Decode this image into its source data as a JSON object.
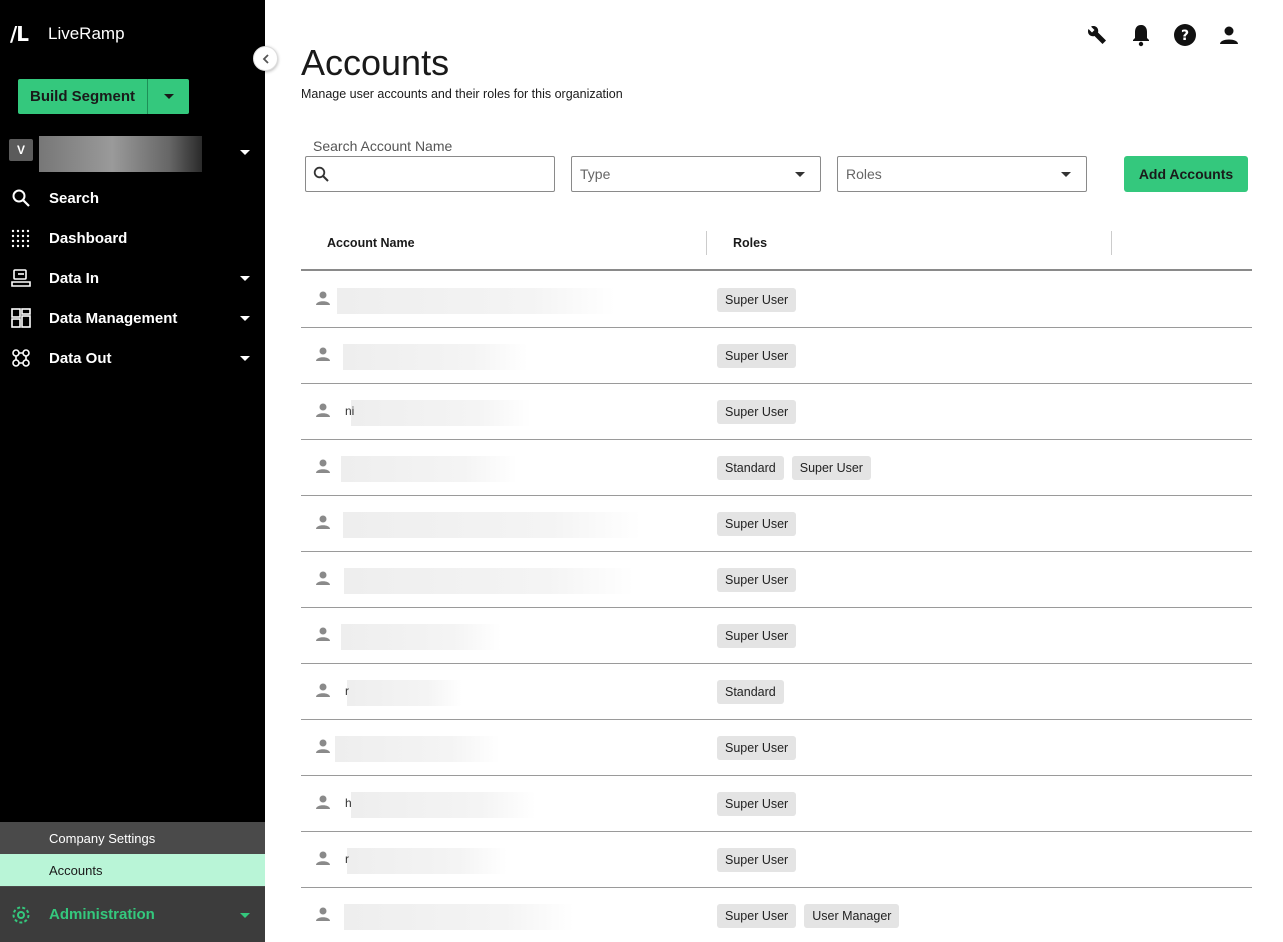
{
  "brand": {
    "mark": "/L",
    "name": "LiveRamp"
  },
  "sidebar": {
    "build_button": "Build Segment",
    "org_badge": "V",
    "nav": [
      {
        "label": "Search",
        "icon": "search-icon",
        "has_caret": false
      },
      {
        "label": "Dashboard",
        "icon": "dashboard-icon",
        "has_caret": false
      },
      {
        "label": "Data In",
        "icon": "data-in-icon",
        "has_caret": true
      },
      {
        "label": "Data Management",
        "icon": "data-management-icon",
        "has_caret": true
      },
      {
        "label": "Data Out",
        "icon": "data-out-icon",
        "has_caret": true
      }
    ],
    "admin_sub": [
      "Company Settings",
      "Accounts"
    ],
    "admin_label": "Administration"
  },
  "header": {
    "icons": [
      "wrench-icon",
      "bell-icon",
      "help-icon",
      "account-icon"
    ]
  },
  "page": {
    "title": "Accounts",
    "subtitle": "Manage user accounts and their roles for this organization"
  },
  "filters": {
    "search_label": "Search Account Name",
    "search_value": "",
    "type_placeholder": "Type",
    "roles_placeholder": "Roles",
    "add_button": "Add Accounts"
  },
  "table": {
    "columns": [
      "Account Name",
      "Roles"
    ],
    "rows": [
      {
        "initial": "",
        "roles": [
          "Super User"
        ]
      },
      {
        "initial": "",
        "roles": [
          "Super User"
        ]
      },
      {
        "initial": "ni",
        "roles": [
          "Super User"
        ]
      },
      {
        "initial": "",
        "roles": [
          "Standard",
          "Super User"
        ]
      },
      {
        "initial": "",
        "roles": [
          "Super User"
        ]
      },
      {
        "initial": "",
        "roles": [
          "Super User"
        ]
      },
      {
        "initial": "",
        "roles": [
          "Super User"
        ]
      },
      {
        "initial": "r",
        "roles": [
          "Standard"
        ]
      },
      {
        "initial": "",
        "roles": [
          "Super User"
        ]
      },
      {
        "initial": "h",
        "roles": [
          "Super User"
        ]
      },
      {
        "initial": "r",
        "roles": [
          "Super User"
        ]
      },
      {
        "initial": "",
        "roles": [
          "Super User",
          "User Manager"
        ]
      }
    ]
  },
  "colors": {
    "accent": "#34c87d",
    "active_sub_bg": "#b9f5d7",
    "sidebar_bg": "#000000"
  }
}
